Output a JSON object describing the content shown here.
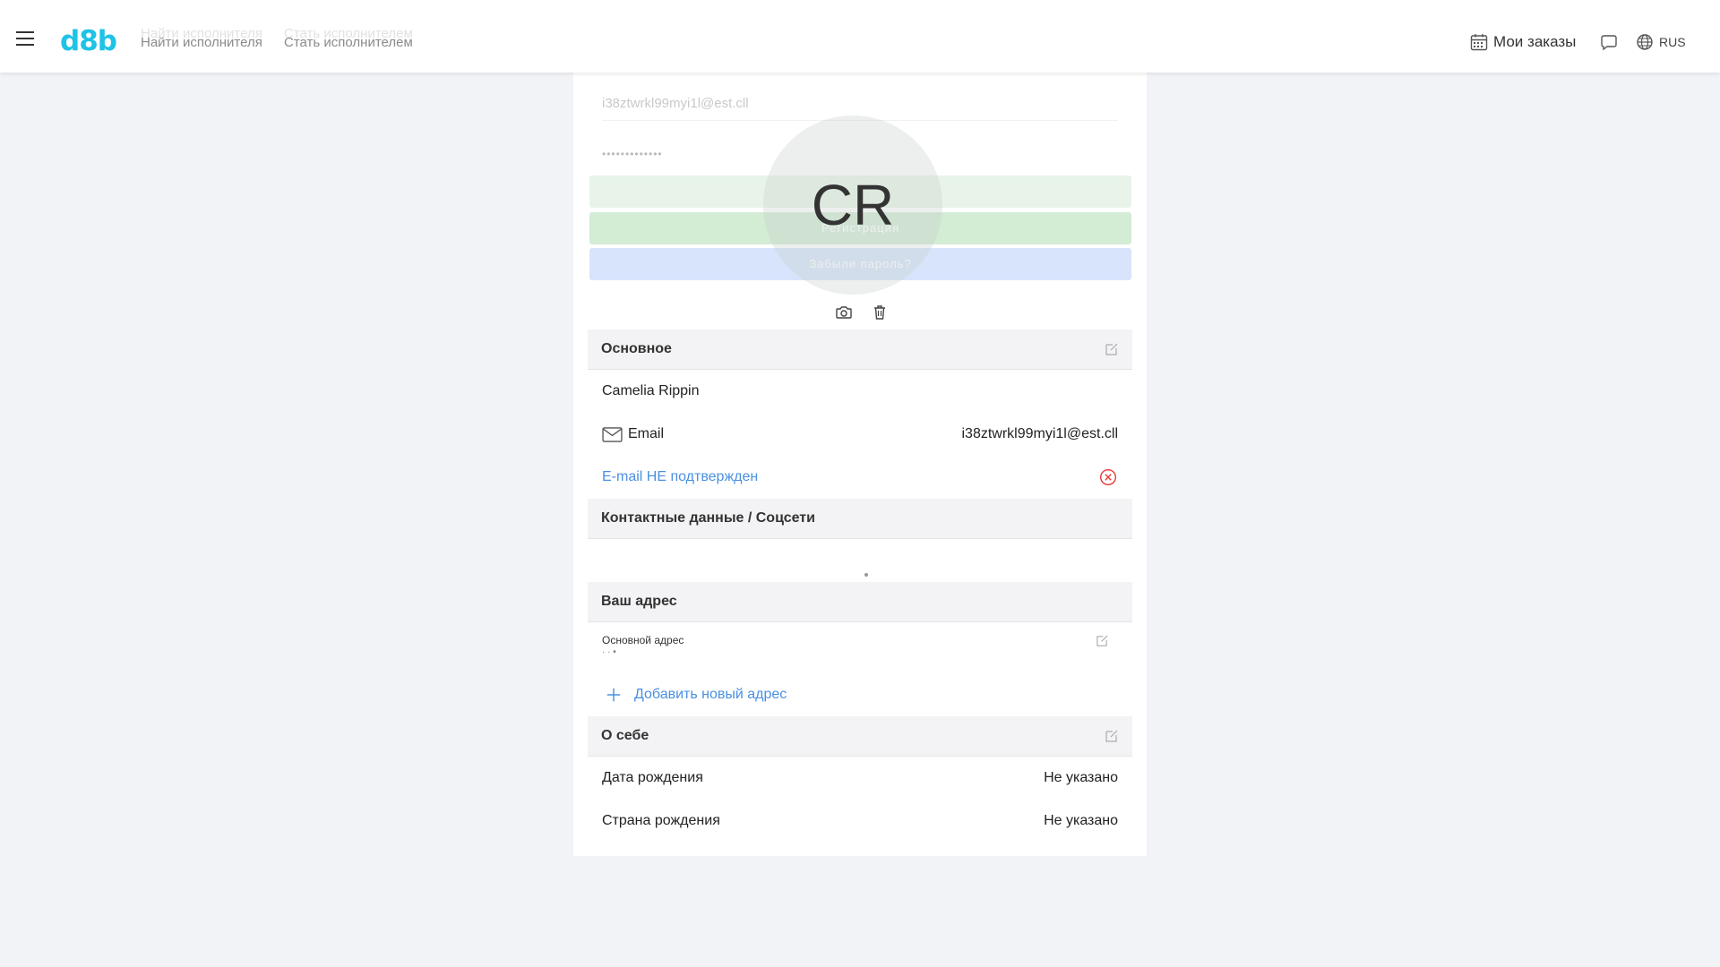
{
  "header": {
    "logo": "d8b",
    "nav": [
      {
        "label": "Найти исполнителя"
      },
      {
        "label": "Стать исполнителем"
      }
    ],
    "orders_label": "Мои заказы",
    "language": "RUS"
  },
  "ghost_form": {
    "email_value": "i38ztwrkl99myi1l@est.cll",
    "password_value": "•••••••••••••",
    "register_label": "Регистрация",
    "forgot_label": "Забыли пароль?"
  },
  "avatar": {
    "initials": "CR"
  },
  "sections": {
    "basic": {
      "title": "Основное",
      "name": "Camelia Rippin",
      "email_label": "Email",
      "email_value": "i38ztwrkl99myi1l@est.cll",
      "email_status": "E-mail НЕ подтвержден"
    },
    "contacts": {
      "title": "Контактные данные / Соцсети"
    },
    "address": {
      "title": "Ваш адрес",
      "primary_label": "Основной адрес",
      "primary_value": "· · •",
      "add_label": "Добавить новый адрес"
    },
    "about": {
      "title": "О себе",
      "birth_date_label": "Дата рождения",
      "birth_date_value": "Не указано",
      "birth_country_label": "Страна рождения",
      "birth_country_value": "Не указано"
    }
  },
  "colors": {
    "accent": "#4a90e2",
    "logo": "#1ec3e6",
    "error": "#e53935"
  }
}
